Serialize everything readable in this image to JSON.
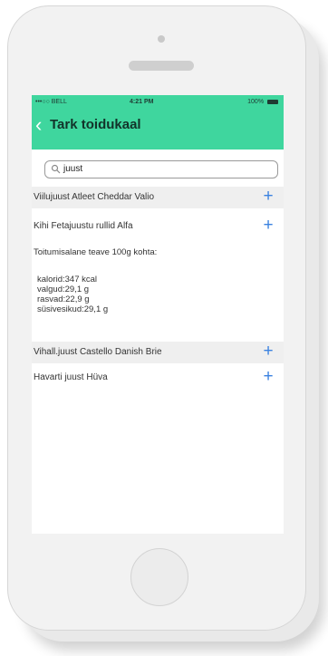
{
  "status": {
    "carrier": "•••○○ BELL",
    "time": "4:21 PM",
    "battery": "100%"
  },
  "header": {
    "title": "Tark toidukaal"
  },
  "search": {
    "value": "juust"
  },
  "items": [
    {
      "label": "Viilujuust Atleet Cheddar Valio"
    },
    {
      "label": "Kihi Fetajuustu rullid Alfa"
    },
    {
      "label": "Vihall.juust Castello Danish Brie"
    },
    {
      "label": "Havarti juust Hüva"
    }
  ],
  "details": {
    "heading": "Toitumisalane teave 100g kohta:",
    "nutrients": [
      "kalorid:347 kcal",
      "valgud:29,1 g",
      "rasvad:22,9 g",
      "süsivesikud:29,1 g"
    ]
  },
  "colors": {
    "accent": "#3fd69e",
    "plus": "#3b82e0"
  },
  "icons": {
    "back": "back-chevron-icon",
    "search": "search-icon",
    "add": "plus-icon"
  }
}
